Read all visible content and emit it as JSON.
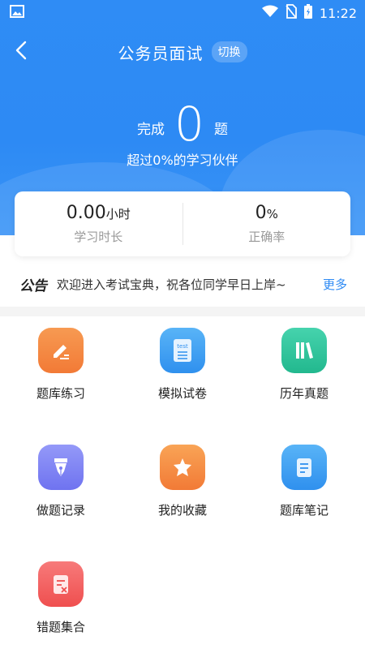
{
  "status_bar": {
    "time": "11:22"
  },
  "nav": {
    "title": "公务员面试",
    "switch_label": "切换"
  },
  "progress": {
    "prefix": "完成",
    "count": "0",
    "suffix": "题",
    "surpass_text": "超过0%的学习伙伴"
  },
  "stats": {
    "study_time": {
      "value": "0.00",
      "unit": "小时",
      "label": "学习时长"
    },
    "accuracy": {
      "value": "0",
      "unit": "%",
      "label": "正确率"
    }
  },
  "notice": {
    "tag": "公告",
    "text": "欢迎进入考试宝典，祝各位同学早日上岸~",
    "more": "更多"
  },
  "menu": [
    {
      "label": "题库练习",
      "icon": "pencil-icon",
      "color": "#f5803e"
    },
    {
      "label": "模拟试卷",
      "icon": "test-paper-icon",
      "color": "#3aa0f2"
    },
    {
      "label": "历年真题",
      "icon": "books-icon",
      "color": "#2cc29a"
    },
    {
      "label": "做题记录",
      "icon": "pen-nib-icon",
      "color": "#7b7ff5"
    },
    {
      "label": "我的收藏",
      "icon": "star-icon",
      "color": "#f58a3a"
    },
    {
      "label": "题库笔记",
      "icon": "note-icon",
      "color": "#3aa0f2"
    },
    {
      "label": "错题集合",
      "icon": "wrong-note-icon",
      "color": "#f25c5c"
    }
  ]
}
